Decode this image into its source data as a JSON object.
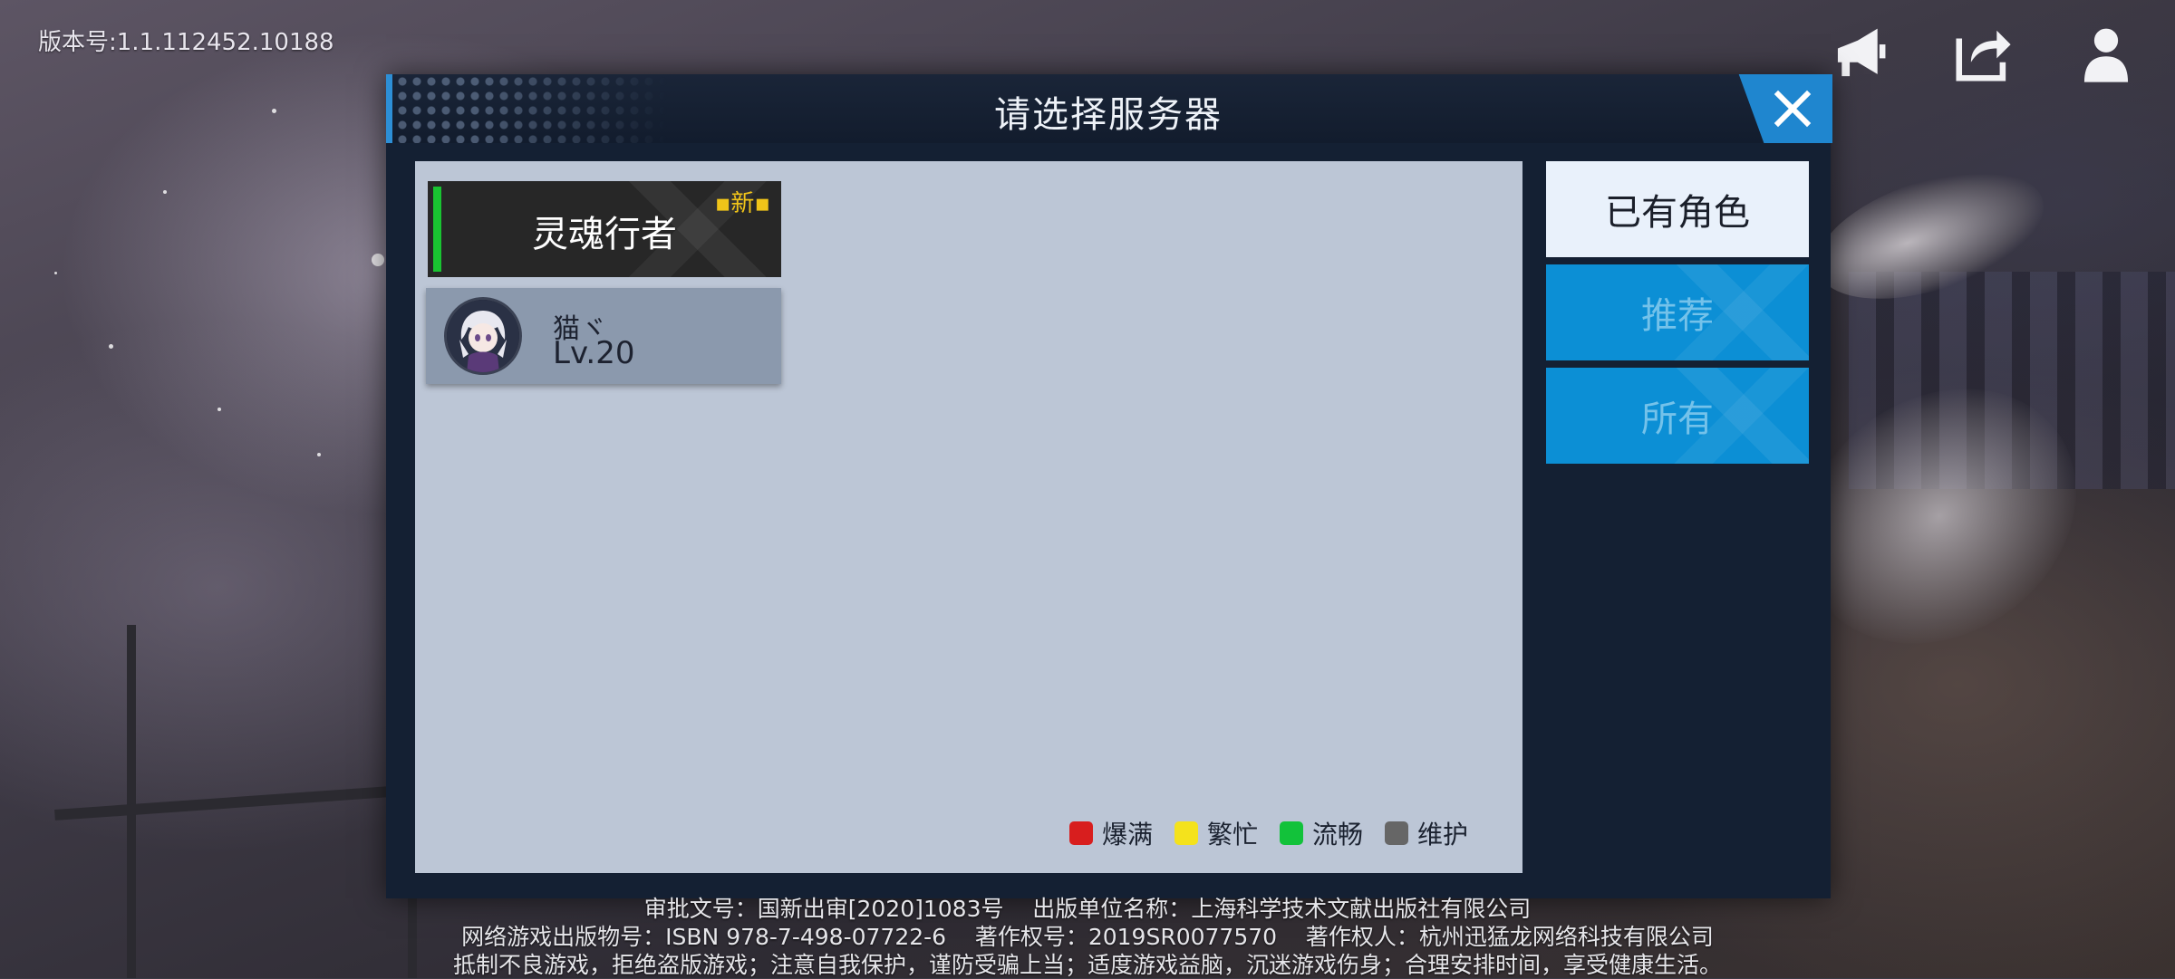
{
  "version_text": "版本号:1.1.112452.10188",
  "top_icons": [
    {
      "icon": "megaphone-icon"
    },
    {
      "icon": "share-icon"
    },
    {
      "icon": "user-icon"
    }
  ],
  "dialog": {
    "title": "请选择服务器",
    "close_icon": "close-icon"
  },
  "server": {
    "name": "灵魂行者",
    "tag": "▪新▪",
    "status_color": "#19c431"
  },
  "character": {
    "name": "猫ヾ",
    "level": "Lv.20"
  },
  "tabs": [
    {
      "label": "已有角色",
      "active": true
    },
    {
      "label": "推荐",
      "active": false
    },
    {
      "label": "所有",
      "active": false
    }
  ],
  "legend": [
    {
      "label": "爆满",
      "color": "#d81e1e"
    },
    {
      "label": "繁忙",
      "color": "#f4e21c"
    },
    {
      "label": "流畅",
      "color": "#12c23a"
    },
    {
      "label": "维护",
      "color": "#666666"
    }
  ],
  "footer": {
    "line1": "审批文号：国新出审[2020]1083号    出版单位名称：上海科学技术文献出版社有限公司",
    "line2": "网络游戏出版物号：ISBN 978-7-498-07722-6    著作权号：2019SR0077570    著作权人：杭州迅猛龙网络科技有限公司",
    "line3": "抵制不良游戏，拒绝盗版游戏；注意自我保护，谨防受骗上当；适度游戏益脑，沉迷游戏伤身；合理安排时间，享受健康生活。"
  }
}
